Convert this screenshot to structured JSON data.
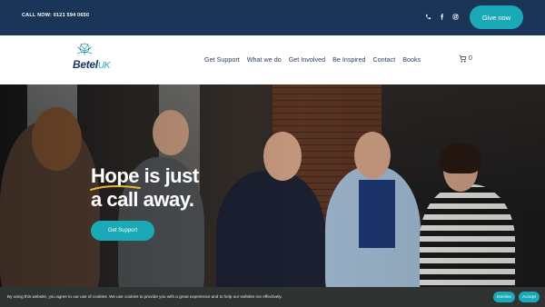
{
  "topbar": {
    "call_label": "CALL NOW: 0121 594 0650",
    "social": [
      "phone-icon",
      "facebook-icon",
      "instagram-icon"
    ],
    "give_label": "Give now"
  },
  "logo": {
    "main": "Betel",
    "suffix": "UK"
  },
  "nav": {
    "items": [
      "Get Support",
      "What we do",
      "Get Involved",
      "Be Inspired",
      "Contact",
      "Books"
    ],
    "cart_count": "0"
  },
  "hero": {
    "line1": "Hope is just",
    "line2": "a call away.",
    "cta": "Get Support"
  },
  "cookie": {
    "text": "By using this website, you agree to our use of cookies. We use cookies to provide you with a great experience and to help our website run effectively.",
    "decline": "Decline",
    "accept": "Accept"
  },
  "colors": {
    "navy": "#1b3558",
    "teal": "#1aa9b6",
    "cookie_bg": "#2f3332"
  }
}
